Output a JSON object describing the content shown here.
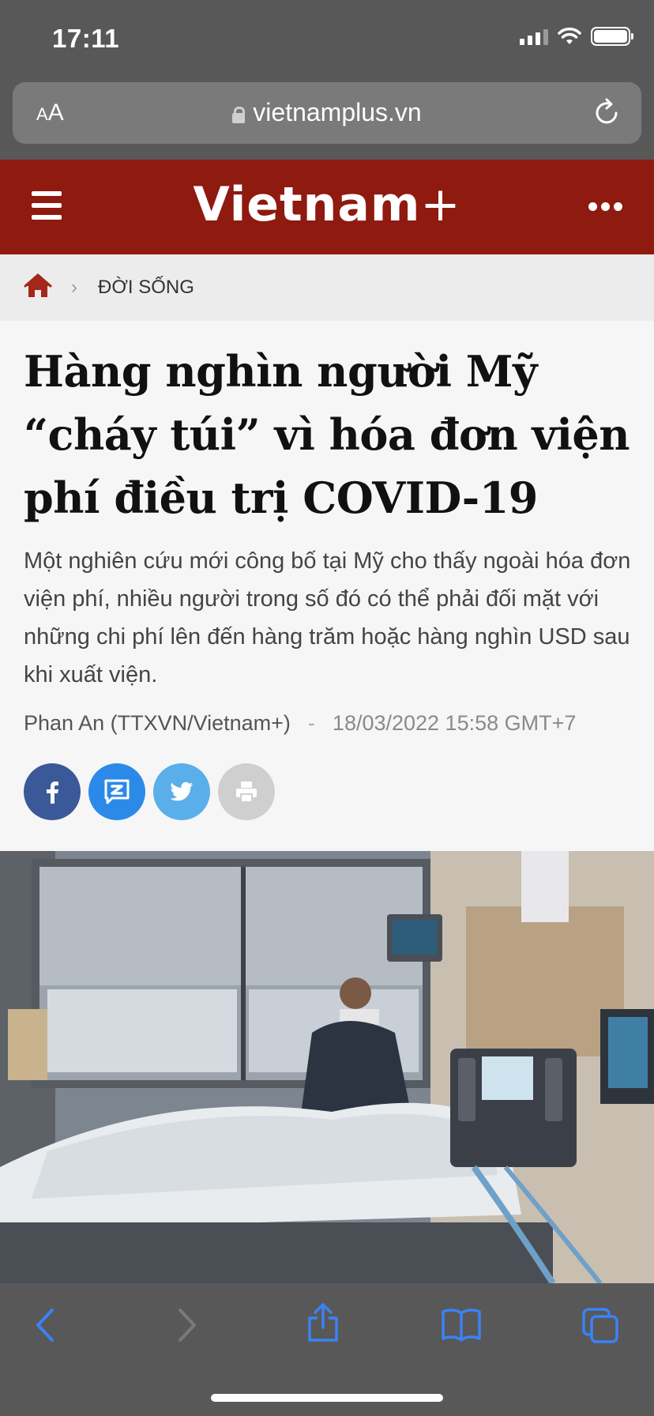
{
  "status_bar": {
    "time": "17:11"
  },
  "browser": {
    "text_size_label_small": "A",
    "text_size_label_large": "A",
    "url": "vietnamplus.vn"
  },
  "site": {
    "logo_text": "Vietnam",
    "logo_plus": "+",
    "brand_color": "#8e1a10"
  },
  "breadcrumb": {
    "section": "ĐỜI SỐNG"
  },
  "article": {
    "headline": "Hàng nghìn người Mỹ “cháy túi” vì hóa đơn viện phí điều trị COVID-19",
    "summary": "Một nghiên cứu mới công bố tại Mỹ cho thấy ngoài hóa đơn viện phí, nhiều người trong số đó có thể phải đối mặt với những chi phí lên đến hàng trăm hoặc hàng nghìn USD sau khi xuất viện.",
    "author": "Phan An (TTXVN/Vietnam+)",
    "separator": "-",
    "date": "18/03/2022 15:58 GMT+7"
  },
  "share": {
    "icons": [
      "facebook-icon",
      "zalo-icon",
      "twitter-icon",
      "print-icon"
    ],
    "colors": {
      "facebook": "#3b5998",
      "zalo": "#2b8ae8",
      "twitter": "#5aaeea",
      "print": "#cfcfcf"
    }
  },
  "toolbar": {
    "icons": [
      "back-icon",
      "forward-icon",
      "share-icon",
      "bookmarks-icon",
      "tabs-icon"
    ],
    "accent": "#3b82f6"
  }
}
